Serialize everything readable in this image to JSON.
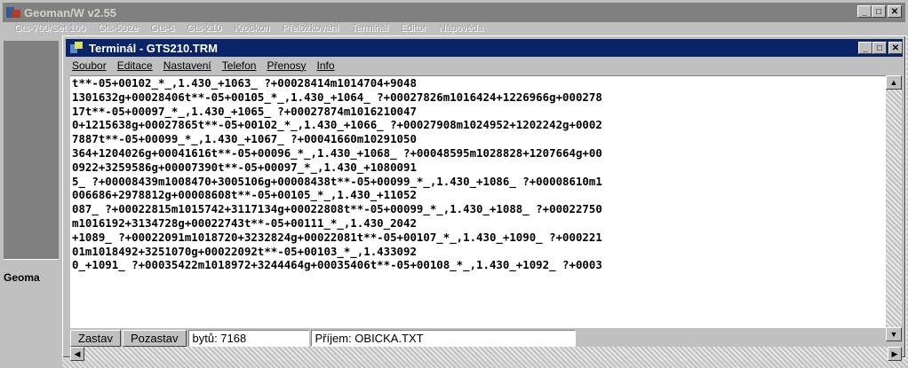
{
  "outer_window": {
    "title": "Geoman/W v2.55",
    "menu": [
      "Gts-700/Set 100",
      "Gts-502e",
      "Gts-6",
      "Gts-210",
      "Kroskon",
      "Přeložkování",
      "Terminál",
      "Editor",
      "Nápověda"
    ],
    "side_label": "Geoma"
  },
  "terminal": {
    "title": "Terminál - GTS210.TRM",
    "menu": [
      "Soubor",
      "Editace",
      "Nastavení",
      "Telefon",
      "Přenosy",
      "Info"
    ],
    "lines": [
      "t**-05+00102_*_,1.430_+1063_ ?+00028414m1014704+9048",
      "1301632g+00028406t**-05+00105_*_,1.430_+1064_ ?+00027826m1016424+1226966g+000278",
      "17t**-05+00097_*_,1.430_+1065_ ?+00027874m1016210047",
      "0+1215638g+00027865t**-05+00102_*_,1.430_+1066_ ?+00027908m1024952+1202242g+0002",
      "7887t**-05+00099_*_,1.430_+1067_ ?+00041660m10291050",
      "364+1204026g+00041616t**-05+00096_*_,1.430_+1068_ ?+00048595m1028828+1207664g+00",
      "0922+3259586g+00007390t**-05+00097_*_,1.430_+1080091",
      "5_ ?+00008439m1008470+3005106g+00008438t**-05+00099_*_,1.430_+1086_ ?+00008610m1",
      "006686+2978812g+00008608t**-05+00105_*_,1.430_+11052",
      "087_ ?+00022815m1015742+3117134g+00022808t**-05+00099_*_,1.430_+1088_ ?+00022750",
      "m1016192+3134728g+00022743t**-05+00111_*_,1.430_2042",
      "+1089_ ?+00022091m1018720+3232824g+00022081t**-05+00107_*_,1.430_+1090_ ?+000221",
      "01m1018492+3251070g+00022092t**-05+00103_*_,1.433092",
      "0_+1091_ ?+00035422m1018972+3244464g+00035406t**-05+00108_*_,1.430_+1092_ ?+0003"
    ],
    "status": {
      "stop_label": "Zastav",
      "pause_label": "Pozastav",
      "bytes_text": "bytů: 7168",
      "receive_text": "Příjem: OBICKA.TXT"
    }
  }
}
